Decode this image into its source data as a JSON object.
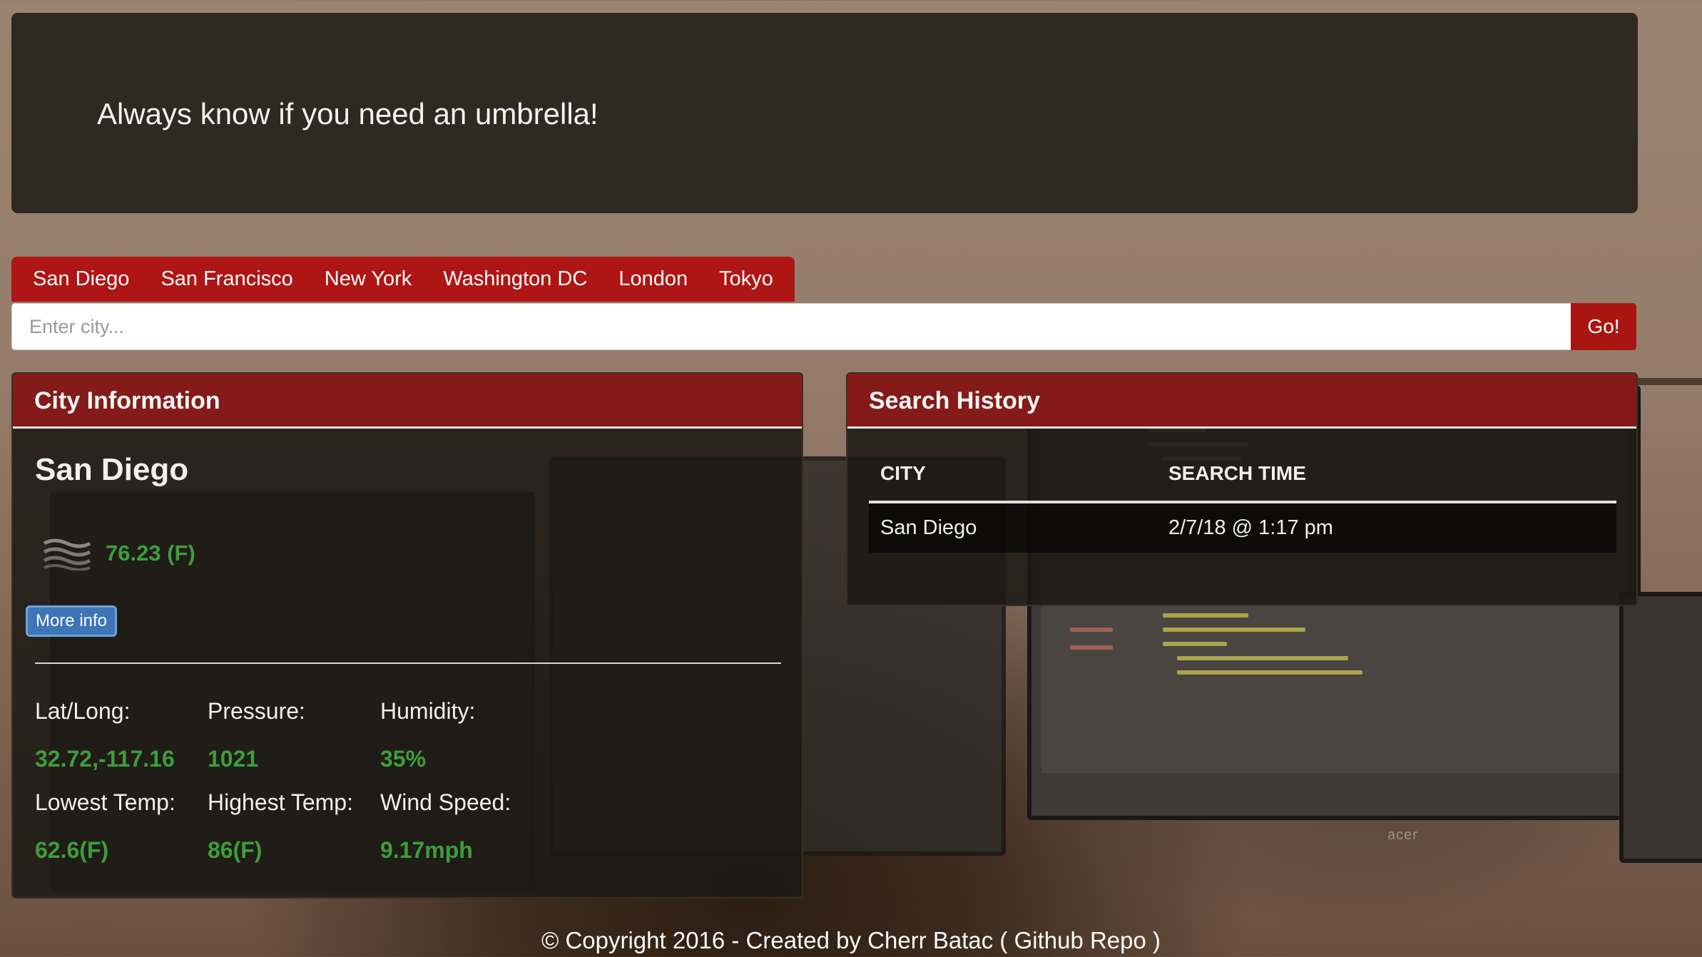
{
  "header": {
    "tagline": "Always know if you need an umbrella!"
  },
  "city_tabs": [
    "San Diego",
    "San Francisco",
    "New York",
    "Washington DC",
    "London",
    "Tokyo"
  ],
  "search": {
    "placeholder": "Enter city...",
    "value": "",
    "button_label": "Go!"
  },
  "city_info": {
    "heading": "City Information",
    "city": "San Diego",
    "weather_icon": "mist-icon",
    "temperature": "76.23 (F)",
    "more_info_label": "More info",
    "stats": [
      {
        "label": "Lat/Long:",
        "value": "32.72,-117.16"
      },
      {
        "label": "Pressure:",
        "value": "1021"
      },
      {
        "label": "Humidity:",
        "value": "35%"
      },
      {
        "label": "Lowest Temp:",
        "value": "62.6(F)"
      },
      {
        "label": "Highest Temp:",
        "value": "86(F)"
      },
      {
        "label": "Wind Speed:",
        "value": "9.17mph"
      }
    ]
  },
  "search_history": {
    "heading": "Search History",
    "columns": [
      "CITY",
      "SEARCH TIME"
    ],
    "rows": [
      [
        "San Diego",
        "2/7/18 @ 1:17 pm"
      ]
    ]
  },
  "background": {
    "monitor_brand": "acer"
  },
  "footer": {
    "text": "© Copyright 2016 - Created by Cherr Batac ( Github Repo )"
  },
  "colors": {
    "accent_red": "#af1515",
    "value_green": "#3d9e3a",
    "button_blue": "#3c76b6"
  }
}
